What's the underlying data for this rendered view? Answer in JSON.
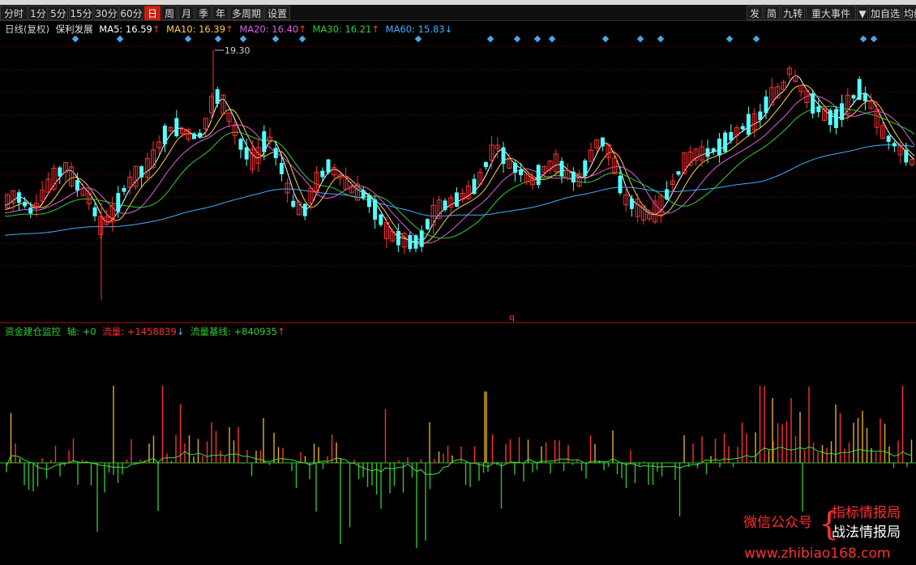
{
  "toolbar": {
    "left": [
      {
        "label": "分时",
        "active": false
      },
      {
        "label": "1分",
        "active": false
      },
      {
        "label": "5分",
        "active": false
      },
      {
        "label": "15分",
        "active": false
      },
      {
        "label": "30分",
        "active": false
      },
      {
        "label": "60分",
        "active": false
      },
      {
        "label": "日",
        "active": true
      },
      {
        "label": "周",
        "active": false
      },
      {
        "label": "月",
        "active": false
      },
      {
        "label": "季",
        "active": false
      },
      {
        "label": "年",
        "active": false
      },
      {
        "label": "多周期",
        "active": false
      },
      {
        "label": "设置",
        "active": false
      }
    ],
    "right": [
      "发",
      "简",
      "九转",
      "重大事件",
      "▼",
      "加自选",
      "均线"
    ]
  },
  "main_chart": {
    "period_label": "日线(复权)",
    "stock_name": "保利发展",
    "ma": [
      {
        "label": "MA5: 16.59",
        "arrow": "↑",
        "color": "#ffffff",
        "arrow_color": "#ff4040"
      },
      {
        "label": "MA10: 16.39",
        "arrow": "↑",
        "color": "#ffd040",
        "arrow_color": "#ff4040"
      },
      {
        "label": "MA20: 16.40",
        "arrow": "↑",
        "color": "#e060e0",
        "arrow_color": "#ff4040"
      },
      {
        "label": "MA30: 16.21",
        "arrow": "↑",
        "color": "#30d030",
        "arrow_color": "#ff4040"
      },
      {
        "label": "MA60: 15.83",
        "arrow": "↓",
        "color": "#40b0ff",
        "arrow_color": "#40b0ff"
      }
    ],
    "high_marker": "19.30",
    "bottom_marker": "q"
  },
  "sub_chart": {
    "title": "资金建仓监控",
    "axis_label": "轴: +0",
    "flow_label": "流量: +1458839",
    "flow_arrow": "↓",
    "baseline_label": "流量基线: +840935",
    "baseline_arrow": "↑"
  },
  "watermark": {
    "account": "微信公众号",
    "line1": "指标情报局",
    "line2": "战法情报局",
    "url": "www.zhibiao168.com"
  },
  "colors": {
    "up": "#ff3030",
    "down": "#54ffff",
    "flow_up": "#ff3030",
    "flow_gold": "#e0b020",
    "flow_down": "#30c030",
    "grid": "#8b0000"
  }
}
